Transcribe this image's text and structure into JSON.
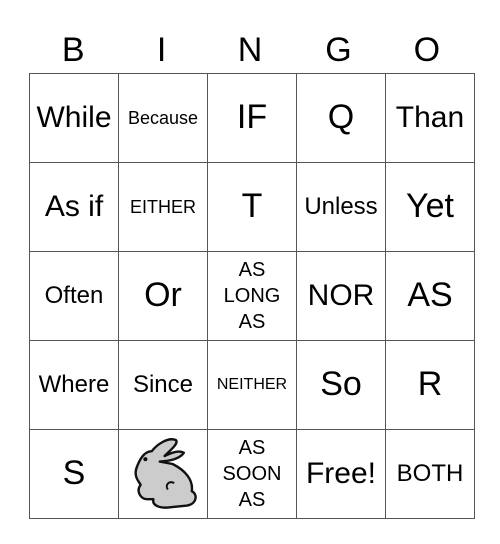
{
  "title_letters": [
    "B",
    "I",
    "N",
    "G",
    "O"
  ],
  "cells": [
    [
      "While",
      "Because",
      "IF",
      "Q",
      "Than"
    ],
    [
      "As if",
      "EITHER",
      "T",
      "Unless",
      "Yet"
    ],
    [
      "Often",
      "Or",
      "AS LONG AS",
      "NOR",
      "AS"
    ],
    [
      "Where",
      "Since",
      "NEITHER",
      "So",
      "R"
    ],
    [
      "S",
      "[bunny-image]",
      "AS SOON AS",
      "Free!",
      "BOTH"
    ]
  ],
  "c": {
    "r0c0": "While",
    "r0c1": "Because",
    "r0c2": "IF",
    "r0c3": "Q",
    "r0c4": "Than",
    "r1c0": "As if",
    "r1c1": "EITHER",
    "r1c2": "T",
    "r1c3": "Unless",
    "r1c4": "Yet",
    "r2c0": "Often",
    "r2c1": "Or",
    "r2c2a": "AS",
    "r2c2b": "LONG",
    "r2c2c": "AS",
    "r2c3": "NOR",
    "r2c4": "AS",
    "r3c0": "Where",
    "r3c1": "Since",
    "r3c2": "NEITHER",
    "r3c3": "So",
    "r3c4": "R",
    "r4c0": "S",
    "r4c2a": "AS",
    "r4c2b": "SOON",
    "r4c2c": "AS",
    "r4c3": "Free!",
    "r4c4": "BOTH"
  },
  "colors": {
    "bunny_fill": "#cccccc",
    "grid_line": "#555555"
  }
}
